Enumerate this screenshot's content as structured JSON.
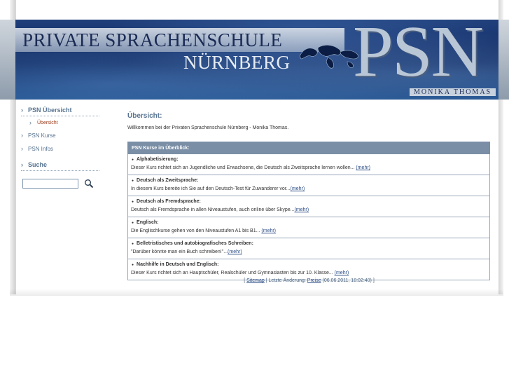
{
  "banner": {
    "title_line1": "PRIVATE SPRACHENSCHULE",
    "title_line2": "NÜRNBERG",
    "logo_text": "PSN",
    "owner": "MONIKA THOMAS",
    "colors": {
      "banner": "#15306a",
      "logo": "#b9c6d6"
    }
  },
  "sidebar": {
    "overview_head": "PSN Übersicht",
    "overview_sub": "Übersicht",
    "items": [
      {
        "label": "PSN Kurse"
      },
      {
        "label": "PSN Infos"
      }
    ],
    "search_head": "Suche",
    "search_value": "",
    "search_icon": "magnifier-icon"
  },
  "main": {
    "heading": "Übersicht:",
    "welcome": "Willkommen bei der Privaten Sprachenschule Nürnberg - Monika Thomas.",
    "table_header": "PSN Kurse im Überblick:",
    "courses": [
      {
        "title": "Alphabetisierung:",
        "text": "Dieser Kurs richtet sich an Jugendliche und Erwachsene, die Deutsch als Zweitsprache lernen wollen... ",
        "more": "(mehr)"
      },
      {
        "title": "Deutsch als Zweitsprache:",
        "text": "In diesem Kurs bereite ich Sie auf den Deutsch-Test für Zuwanderer vor...",
        "more": "(mehr)"
      },
      {
        "title": "Deutsch als Fremdsprache:",
        "text": "Deutsch als Fremdsprache in allen Niveaustufen, auch online über Skype...",
        "more": "(mehr)"
      },
      {
        "title": "Englisch:",
        "text": "Die Englischkurse gehen von den Niveaustufen A1 bis B1... ",
        "more": "(mehr)"
      },
      {
        "title": "Belletristisches und autobiografisches Schreiben:",
        "text": "\"Darüber könnte man ein Buch schreiben!\"...",
        "more": "(mehr)"
      },
      {
        "title": "Nachhilfe in Deutsch und Englisch:",
        "text": "Dieser Kurs richtet sich an Hauptschüler, Realschüler und Gymnasiasten bis zur 10. Klasse... ",
        "more": "(mehr)"
      }
    ],
    "accent_color": "#7a8ea6"
  },
  "footer": {
    "open": "[ ",
    "sitemap": "Sitemap",
    "mid": " | Letzte Änderung: ",
    "page": "Preise",
    "date": " (06.06.2011, 18:02:40) ]"
  }
}
